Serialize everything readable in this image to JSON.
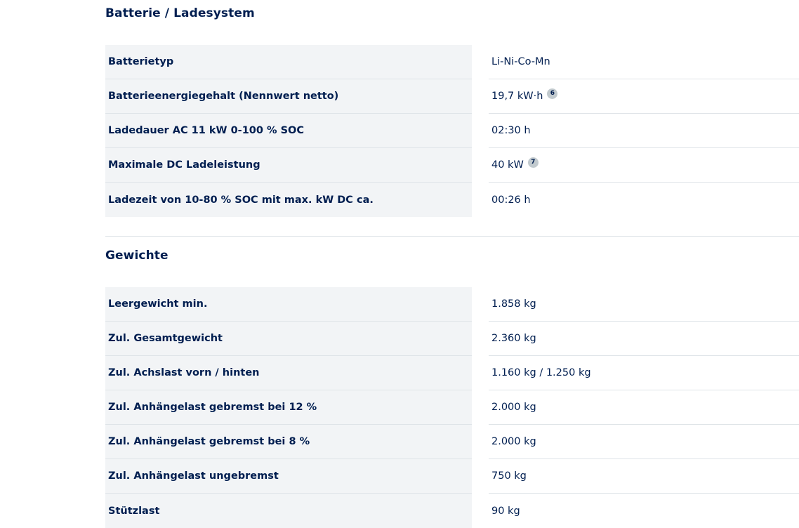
{
  "battery": {
    "title": "Batterie / Ladesystem",
    "rows": [
      {
        "label": "Batterietyp",
        "value": "Li-Ni-Co-Mn"
      },
      {
        "label": "Batterieenergiegehalt (Nennwert netto)",
        "value": "19,7 kW·h",
        "footnote": "6"
      },
      {
        "label": "Ladedauer AC 11 kW 0-100 % SOC",
        "value": "02:30 h"
      },
      {
        "label": "Maximale DC Ladeleistung",
        "value": "40 kW",
        "footnote": "7"
      },
      {
        "label": "Ladezeit von 10-80 % SOC mit max. kW DC ca.",
        "value": "00:26 h"
      }
    ]
  },
  "weights": {
    "title": "Gewichte",
    "rows": [
      {
        "label": "Leergewicht min.",
        "value": "1.858 kg"
      },
      {
        "label": "Zul. Gesamtgewicht",
        "value": "2.360 kg"
      },
      {
        "label": "Zul. Achslast vorn / hinten",
        "value": "1.160 kg / 1.250 kg"
      },
      {
        "label": "Zul. Anhängelast gebremst bei 12 %",
        "value": "2.000 kg"
      },
      {
        "label": "Zul. Anhängelast gebremst bei 8 %",
        "value": "2.000 kg"
      },
      {
        "label": "Zul. Anhängelast ungebremst",
        "value": "750 kg"
      },
      {
        "label": "Stützlast",
        "value": "90 kg"
      }
    ]
  },
  "colors": {
    "text": "#001e50",
    "label_background": "#f2f4f6",
    "divider": "#dfe4e8",
    "footnote_badge": "#c2cace"
  }
}
